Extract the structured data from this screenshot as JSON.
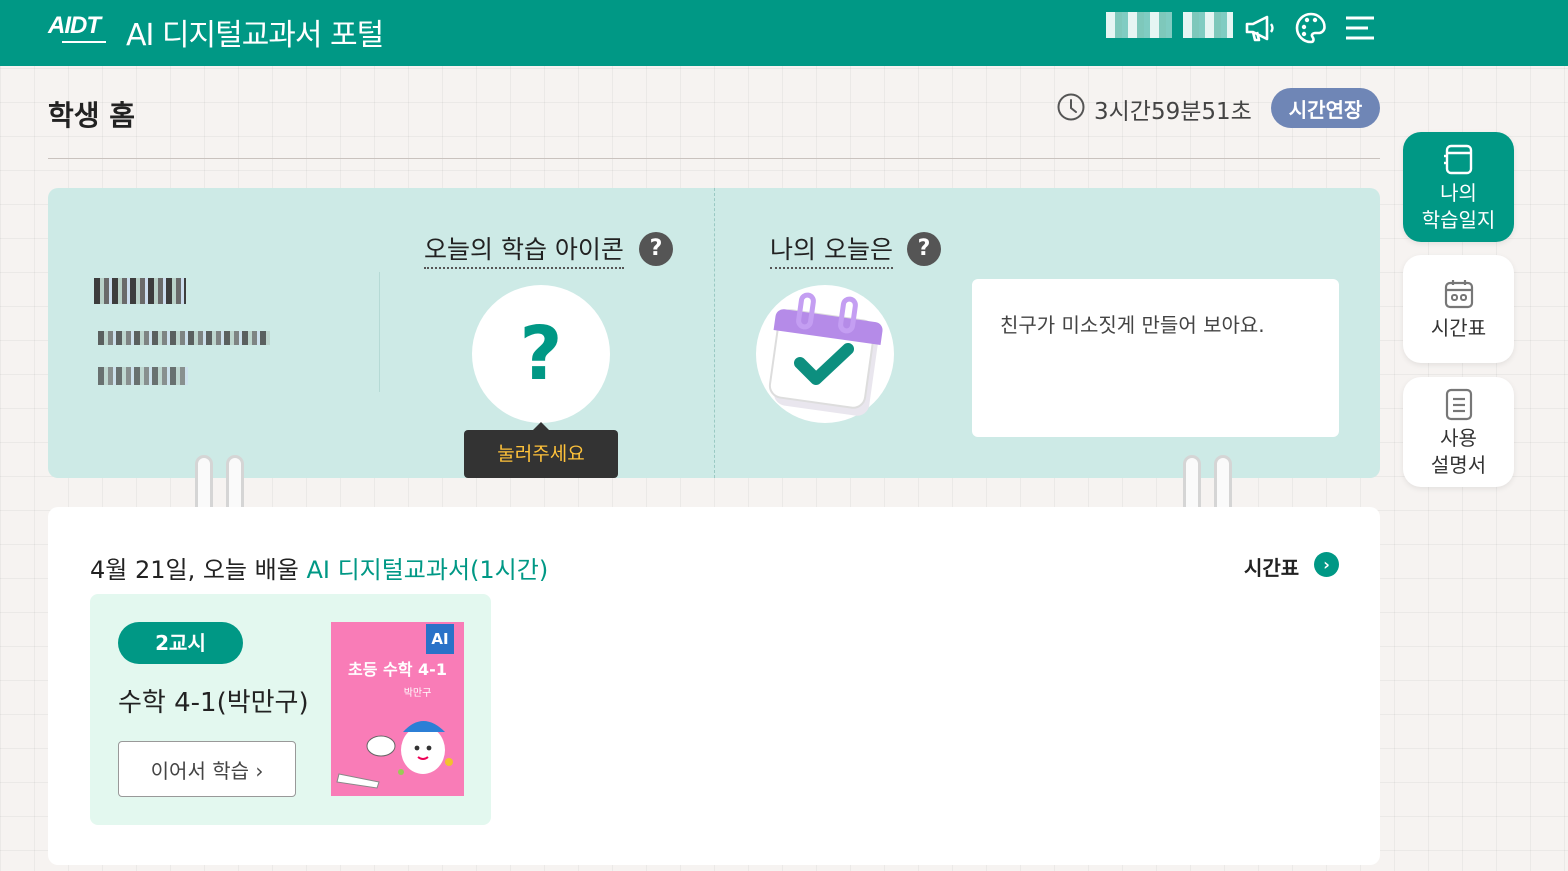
{
  "header": {
    "logo": "AIDT",
    "title": "AI 디지털교과서 포털",
    "icons": [
      "megaphone-icon",
      "palette-icon",
      "menu-icon"
    ]
  },
  "page": {
    "title": "학생 홈",
    "timer": "3시간59분51초",
    "extend_label": "시간연장"
  },
  "sidebar": {
    "items": [
      {
        "label1": "나의",
        "label2": "학습일지",
        "icon": "journal-icon",
        "active": true
      },
      {
        "label1": "시간표",
        "label2": "",
        "icon": "calendar-icon",
        "active": false
      },
      {
        "label1": "사용",
        "label2": "설명서",
        "icon": "document-icon",
        "active": false
      }
    ]
  },
  "today": {
    "icon_heading": "오늘의 학습 아이콘",
    "icon_placeholder": "?",
    "icon_tooltip": "눌러주세요",
    "mood_heading": "나의 오늘은",
    "message": "친구가 미소짓게 만들어 보아요."
  },
  "schedule": {
    "date_text": "4월 21일, 오늘 배울 ",
    "highlight_text": "AI 디지털교과서(1시간)",
    "timetable_link": "시간표",
    "lessons": [
      {
        "period": "2교시",
        "subject": "수학 4-1(박만구)",
        "continue_label": "이어서 학습",
        "book": {
          "badge": "AI",
          "title": "초등 수학 4-1",
          "author": "박만구"
        }
      }
    ]
  },
  "colors": {
    "primary": "#009885",
    "extend": "#6f86b6",
    "tooltip_text": "#ffc23a",
    "book_pink": "#f97cb7"
  }
}
